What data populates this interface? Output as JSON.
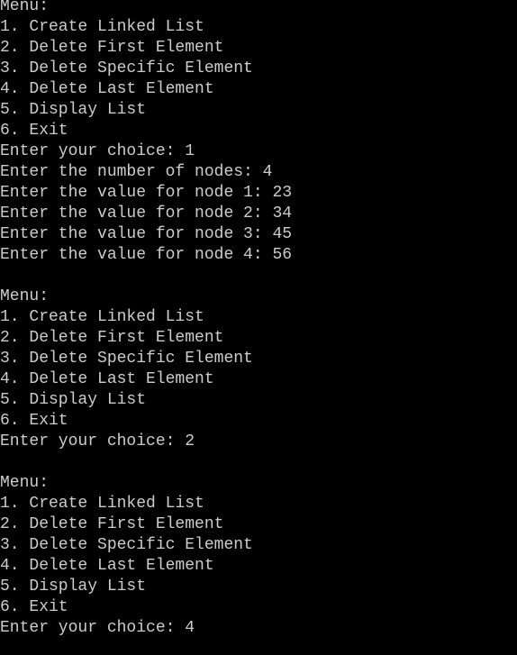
{
  "terminal": {
    "text_color": "#cccccc",
    "background": "#000000",
    "lines": [
      "Menu:",
      "1. Create Linked List",
      "2. Delete First Element",
      "3. Delete Specific Element",
      "4. Delete Last Element",
      "5. Display List",
      "6. Exit",
      "Enter your choice: 1",
      "Enter the number of nodes: 4",
      "Enter the value for node 1: 23",
      "Enter the value for node 2: 34",
      "Enter the value for node 3: 45",
      "Enter the value for node 4: 56",
      "",
      "Menu:",
      "1. Create Linked List",
      "2. Delete First Element",
      "3. Delete Specific Element",
      "4. Delete Last Element",
      "5. Display List",
      "6. Exit",
      "Enter your choice: 2",
      "",
      "Menu:",
      "1. Create Linked List",
      "2. Delete First Element",
      "3. Delete Specific Element",
      "4. Delete Last Element",
      "5. Display List",
      "6. Exit",
      "Enter your choice: 4"
    ]
  }
}
